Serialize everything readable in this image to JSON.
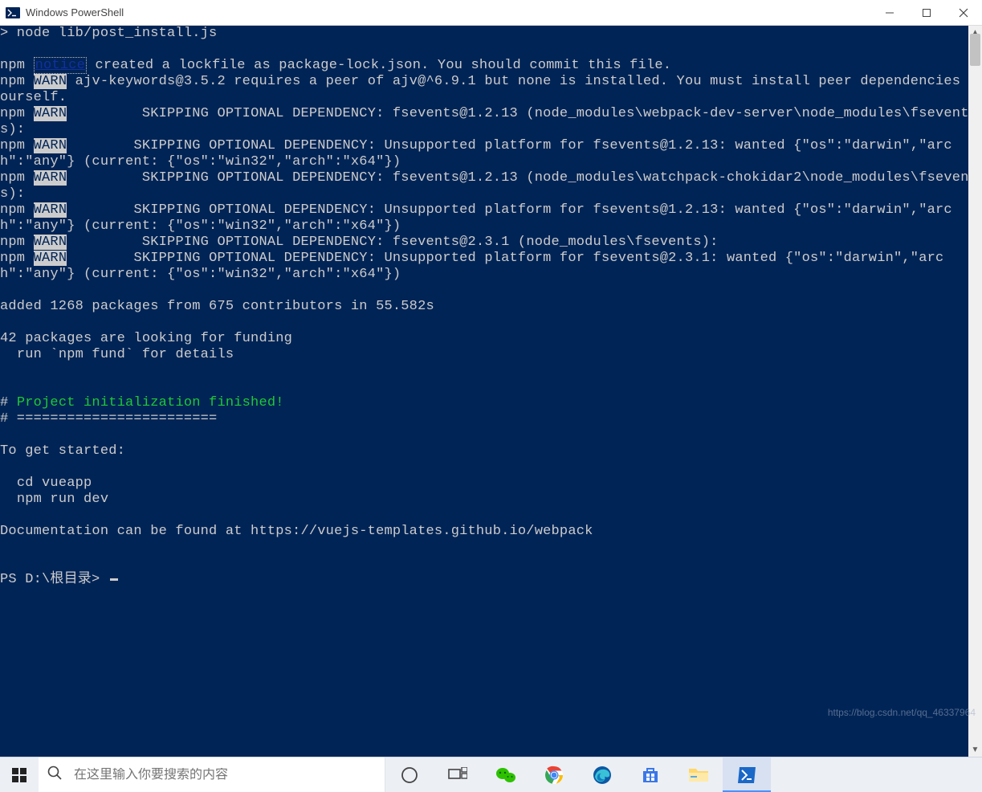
{
  "window": {
    "title": "Windows PowerShell"
  },
  "titlebar_buttons": {
    "minimize": "minimize",
    "maximize": "maximize",
    "close": "close"
  },
  "terminal": {
    "command_line": "> node lib/post_install.js",
    "npm": "npm",
    "notice": "notice",
    "warn": "WARN",
    "lockfile_msg": " created a lockfile as package-lock.json. You should commit this file.",
    "ajv_msg": " ajv-keywords@3.5.2 requires a peer of ajv@^6.9.1 but none is installed. You must install peer dependencies yourself.",
    "skip1": "         SKIPPING OPTIONAL DEPENDENCY: fsevents@1.2.13 (node_modules\\webpack-dev-server\\node_modules\\fsevents):",
    "skip2a": "        SKIPPING OPTIONAL DEPENDENCY: Unsupported platform for fsevents@1.2.13: wanted {\"os\":\"darwin\",\"arch\":\"any\"}",
    "skip2b": " (current: {\"os\":\"win32\",\"arch\":\"x64\"})",
    "skip3a": "         SKIPPING OPTIONAL DEPENDENCY: fsevents@1.2.13 (node_modules\\watchpack-chokidar2\\node_modules\\fsevents):",
    "skip4a": "        SKIPPING OPTIONAL DEPENDENCY: Unsupported platform for fsevents@1.2.13: wanted {\"os\":\"darwin\",\"arch\":\"any\"}",
    "skip4b": " (current: {\"os\":\"win32\",\"arch\":\"x64\"})",
    "skip5": "         SKIPPING OPTIONAL DEPENDENCY: fsevents@2.3.1 (node_modules\\fsevents):",
    "skip6a": "        SKIPPING OPTIONAL DEPENDENCY: Unsupported platform for fsevents@2.3.1: wanted {\"os\":\"darwin\",\"arch\":\"any\"}",
    "skip6b": " (current: {\"os\":\"win32\",\"arch\":\"x64\"})",
    "added": "added 1268 packages from 675 contributors in 55.582s",
    "funding1": "42 packages are looking for funding",
    "funding2": "  run `npm fund` for details",
    "hash_line": "# ========================",
    "proj_init_hash": "# ",
    "proj_init": "Project initialization finished!",
    "get_started": "To get started:",
    "cd": "  cd vueapp",
    "rundev": "  npm run dev",
    "docs": "Documentation can be found at https://vuejs-templates.github.io/webpack",
    "prompt": "PS D:\\根目录> "
  },
  "taskbar": {
    "search_placeholder": "在这里输入你要搜索的内容",
    "icons": [
      "cortana",
      "task-view",
      "wechat",
      "chrome",
      "edge",
      "store",
      "explorer",
      "powershell"
    ]
  },
  "watermark": "https://blog.csdn.net/qq_46337964"
}
